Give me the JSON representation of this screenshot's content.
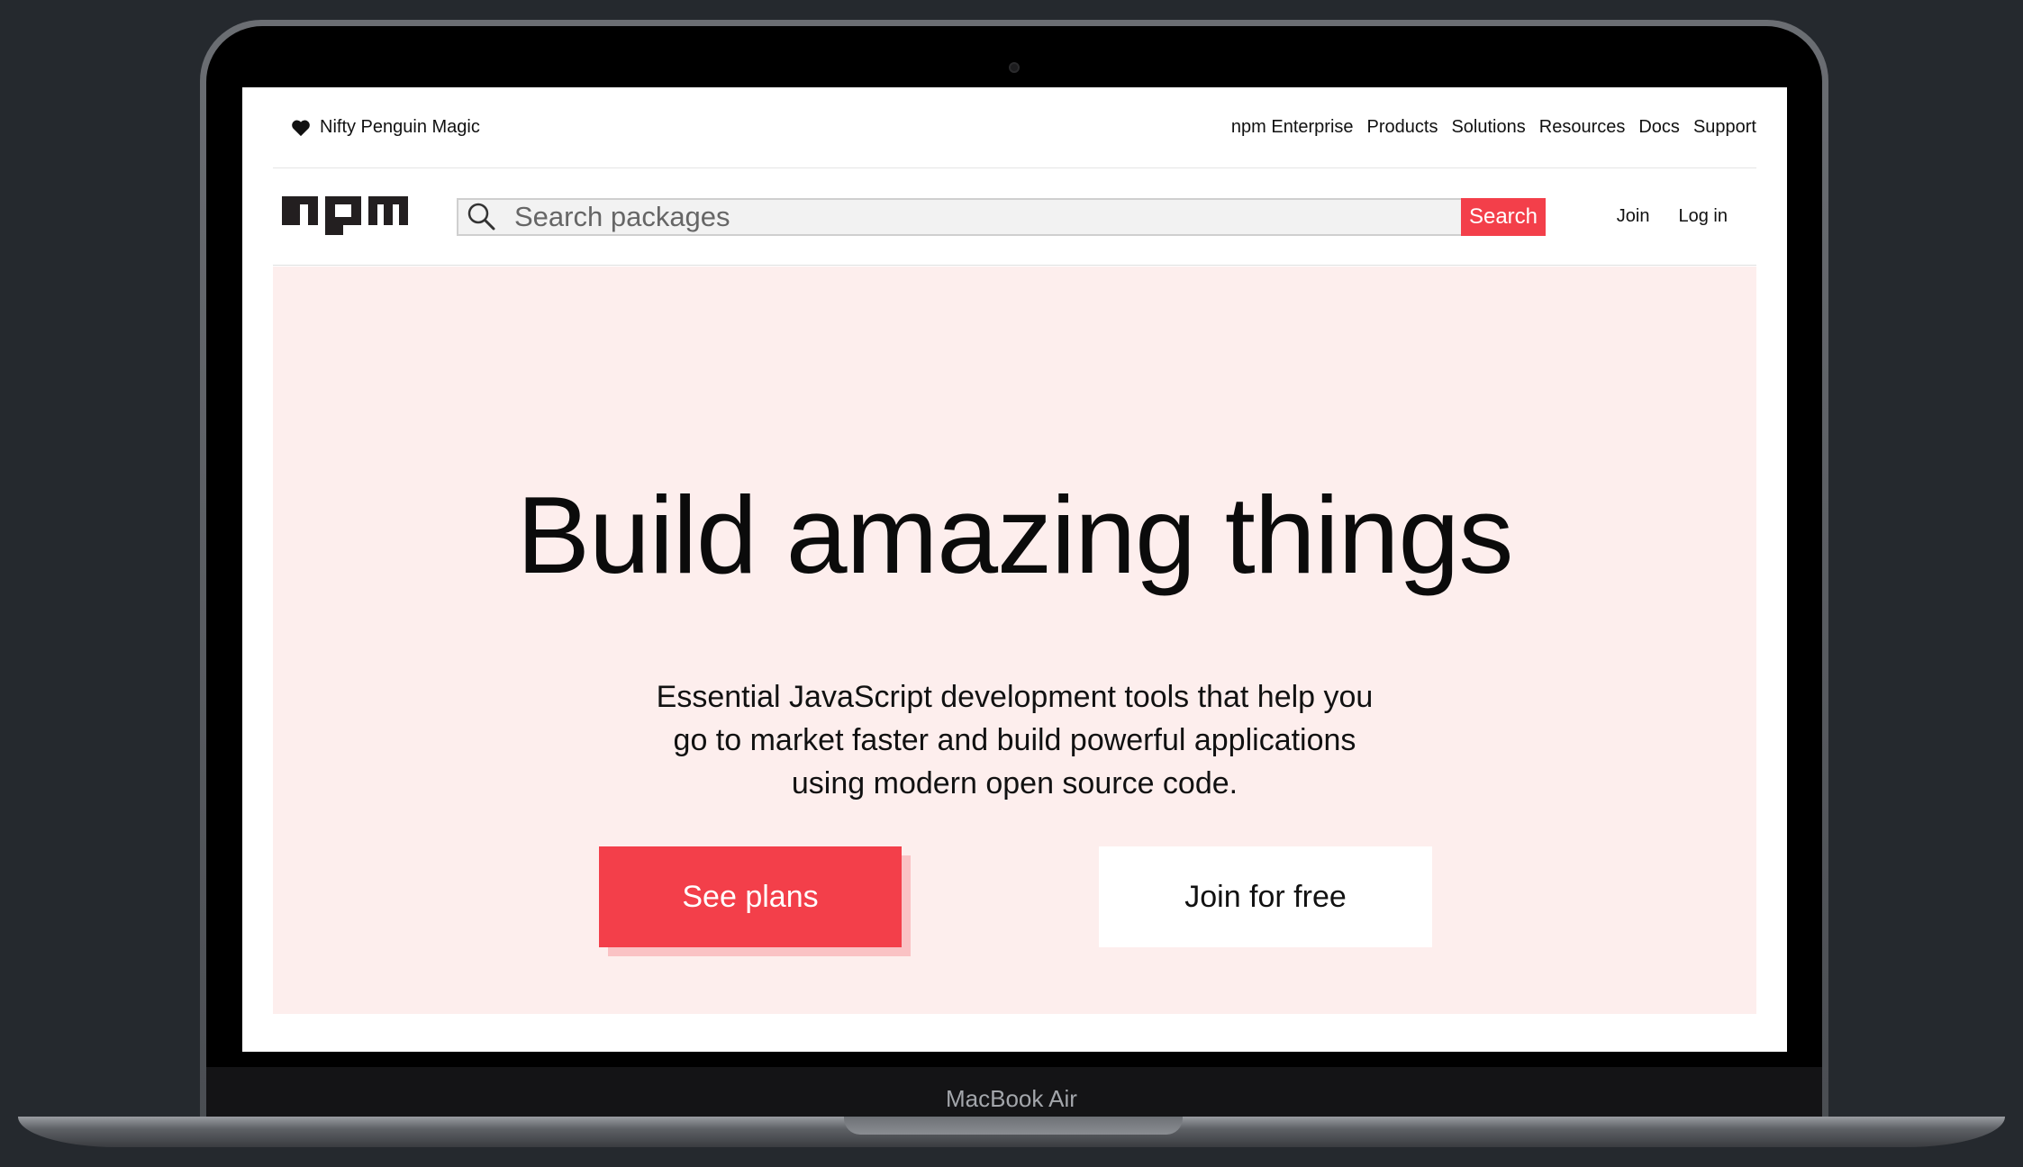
{
  "device": {
    "model_label": "MacBook Air"
  },
  "topbar": {
    "tagline": "Nifty Penguin Magic",
    "nav": [
      "npm Enterprise",
      "Products",
      "Solutions",
      "Resources",
      "Docs",
      "Support"
    ]
  },
  "header": {
    "logo_text": "npm",
    "search": {
      "placeholder": "Search packages",
      "button_label": "Search"
    },
    "join_label": "Join",
    "login_label": "Log in"
  },
  "hero": {
    "title": "Build amazing things",
    "subtitle": "Essential JavaScript development tools that help you go to market faster and build powerful applications using modern open source code.",
    "primary_button": "See plans",
    "secondary_button": "Join for free"
  },
  "colors": {
    "accent": "#f33f4a",
    "hero_background": "#fdeeed",
    "frame_background": "#25292e"
  },
  "icons": {
    "tagline_icon": "heart-icon",
    "search_icon": "search-icon",
    "logo": "npm-logo"
  }
}
